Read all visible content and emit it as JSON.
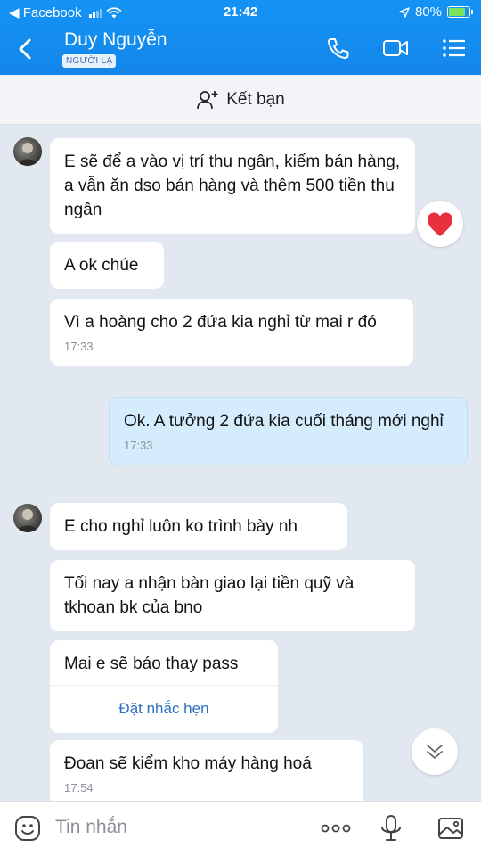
{
  "status": {
    "back_app": "◀ Facebook",
    "time": "21:42",
    "battery": "80%"
  },
  "header": {
    "contact_name": "Duy Nguyễn",
    "tag": "NGƯỜI LẠ"
  },
  "friend_bar": {
    "label": "Kết bạn"
  },
  "messages": [
    {
      "text": "E sẽ để a vào vị trí thu ngân, kiếm bán hàng, a vẫn ăn dso bán hàng và thêm 500 tiền thu ngân"
    },
    {
      "text": "A ok chúe"
    },
    {
      "text": "Vì a hoàng cho 2 đứa kia nghỉ từ mai r đó",
      "time": "17:33"
    },
    {
      "text": "Ok. A tưởng 2 đứa kia cuối tháng mới nghỉ",
      "time": "17:33"
    },
    {
      "text": "E cho nghỉ luôn ko trình bày nh"
    },
    {
      "text": "Tối nay a nhận bàn giao lại tiền quỹ và tkhoan bk của bno"
    },
    {
      "text": "Mai e sẽ báo thay pass",
      "action": "Đặt nhắc hẹn"
    },
    {
      "text": "Đoan sẽ kiểm kho máy hàng hoá",
      "time": "17:54"
    }
  ],
  "input": {
    "placeholder": "Tin nhắn"
  },
  "colors": {
    "header_blue": "#1493f4",
    "my_bubble": "#d5ecfc",
    "link_blue": "#2a6fc0",
    "heart_red": "#e8303f"
  }
}
